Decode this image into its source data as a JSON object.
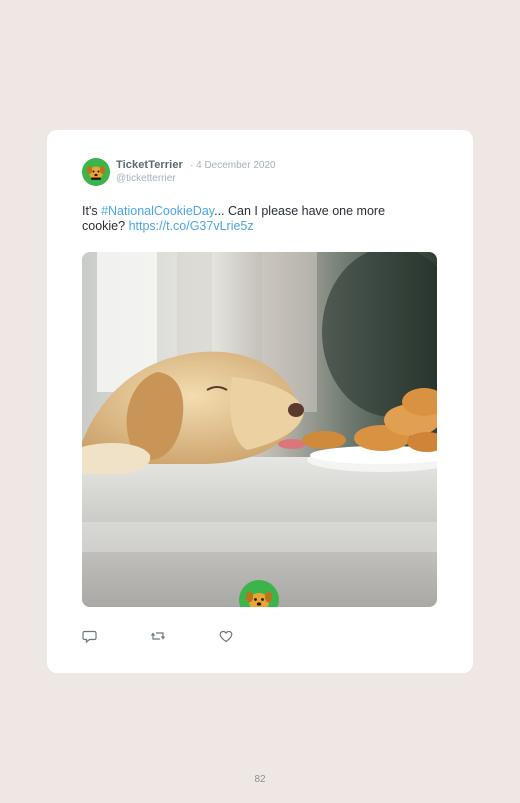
{
  "tweet": {
    "display_name": "TicketTerrier",
    "date": "· 4 December 2020",
    "handle": "@ticketterrier",
    "text_prefix": "It's ",
    "hashtag": "#NationalCookieDay",
    "text_middle": "... Can I please have one more cookie? ",
    "link": "https://t.co/G37vLrie5z",
    "media_icon": "dog-photo",
    "watermark_icon": "terrier-logo"
  },
  "actions": {
    "reply_icon": "reply-icon",
    "retweet_icon": "retweet-icon",
    "like_icon": "heart-icon"
  },
  "page": {
    "number": "82"
  },
  "colors": {
    "background": "#efe7e4",
    "brand_green": "#3bb54a",
    "link_blue": "#4aa6e8"
  }
}
